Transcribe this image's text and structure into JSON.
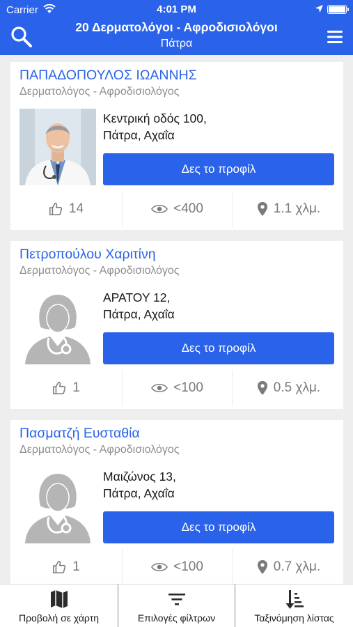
{
  "status_bar": {
    "carrier": "Carrier",
    "time": "4:01 PM"
  },
  "header": {
    "title": "20 Δερματολόγοι - Αφροδισιολόγοι",
    "subtitle": "Πάτρα"
  },
  "doctors": [
    {
      "name": "ΠΑΠΑΔΟΠΟΥΛΟΣ ΙΩΑΝΝΗΣ",
      "specialty": "Δερματολόγος - Αφροδισιολόγος",
      "address_line1": "Κεντρική οδός 100,",
      "address_line2": "Πάτρα, Αχαΐα",
      "profile_button": "Δες το προφίλ",
      "likes": "14",
      "views": "<400",
      "distance": "1.1 χλμ.",
      "photo": "male-doctor-photo"
    },
    {
      "name": "Πετροπούλου Χαριτίνη",
      "specialty": "Δερματολόγος - Αφροδισιολόγος",
      "address_line1": "ΑΡΑΤΟΥ 12,",
      "address_line2": "Πάτρα, Αχαΐα",
      "profile_button": "Δες το προφίλ",
      "likes": "1",
      "views": "<100",
      "distance": "0.5 χλμ.",
      "photo": "female-doctor-placeholder"
    },
    {
      "name": "Πασματζή Ευσταθία",
      "specialty": "Δερματολόγος - Αφροδισιολόγος",
      "address_line1": "Μαιζώνος 13,",
      "address_line2": "Πάτρα, Αχαΐα",
      "profile_button": "Δες το προφίλ",
      "likes": "1",
      "views": "<100",
      "distance": "0.7 χλμ.",
      "photo": "female-doctor-placeholder"
    }
  ],
  "bottom_bar": {
    "map_view": "Προβολή σε χάρτη",
    "filter_options": "Επιλογές φίλτρων",
    "sort_list": "Ταξινόμηση λίστας"
  },
  "colors": {
    "primary": "#2a63ea",
    "background": "#eeeeee",
    "muted_text": "#8e8e8e"
  }
}
